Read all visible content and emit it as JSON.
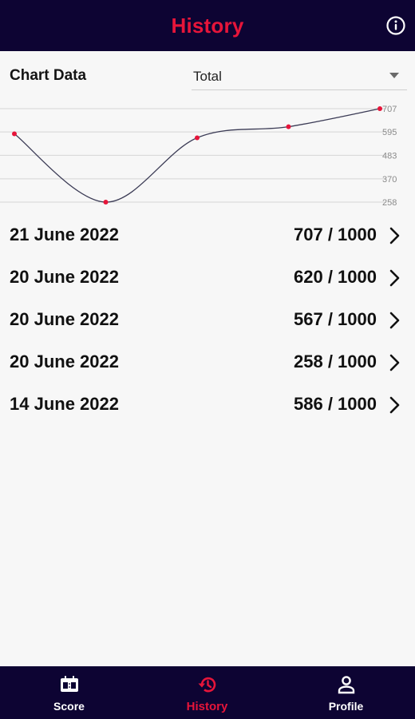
{
  "header": {
    "title": "History"
  },
  "icons": {
    "info": "info-icon",
    "chevron": "chevron-right-icon",
    "score": "scoreboard-icon",
    "history": "history-icon",
    "profile": "person-icon"
  },
  "colors": {
    "bar_bg": "#0d0433",
    "accent": "#e6153a",
    "point": "#e6153a",
    "line": "#3b3b55"
  },
  "chart_header": {
    "label": "Chart Data",
    "selected": "Total"
  },
  "chart_data": {
    "type": "line",
    "x": [
      "14 June 2022",
      "20 June 2022",
      "20 June 2022",
      "20 June 2022",
      "21 June 2022"
    ],
    "values": [
      586,
      258,
      567,
      620,
      707
    ],
    "yticks": [
      "707",
      "595",
      "483",
      "370",
      "258"
    ],
    "ylim": [
      258,
      707
    ],
    "grid": true
  },
  "history": [
    {
      "date": "21 June 2022",
      "score": "707 / 1000"
    },
    {
      "date": "20 June 2022",
      "score": "620 / 1000"
    },
    {
      "date": "20 June 2022",
      "score": "567 / 1000"
    },
    {
      "date": "20 June 2022",
      "score": "258 / 1000"
    },
    {
      "date": "14 June 2022",
      "score": "586 / 1000"
    }
  ],
  "nav": {
    "score": "Score",
    "history": "History",
    "profile": "Profile"
  }
}
